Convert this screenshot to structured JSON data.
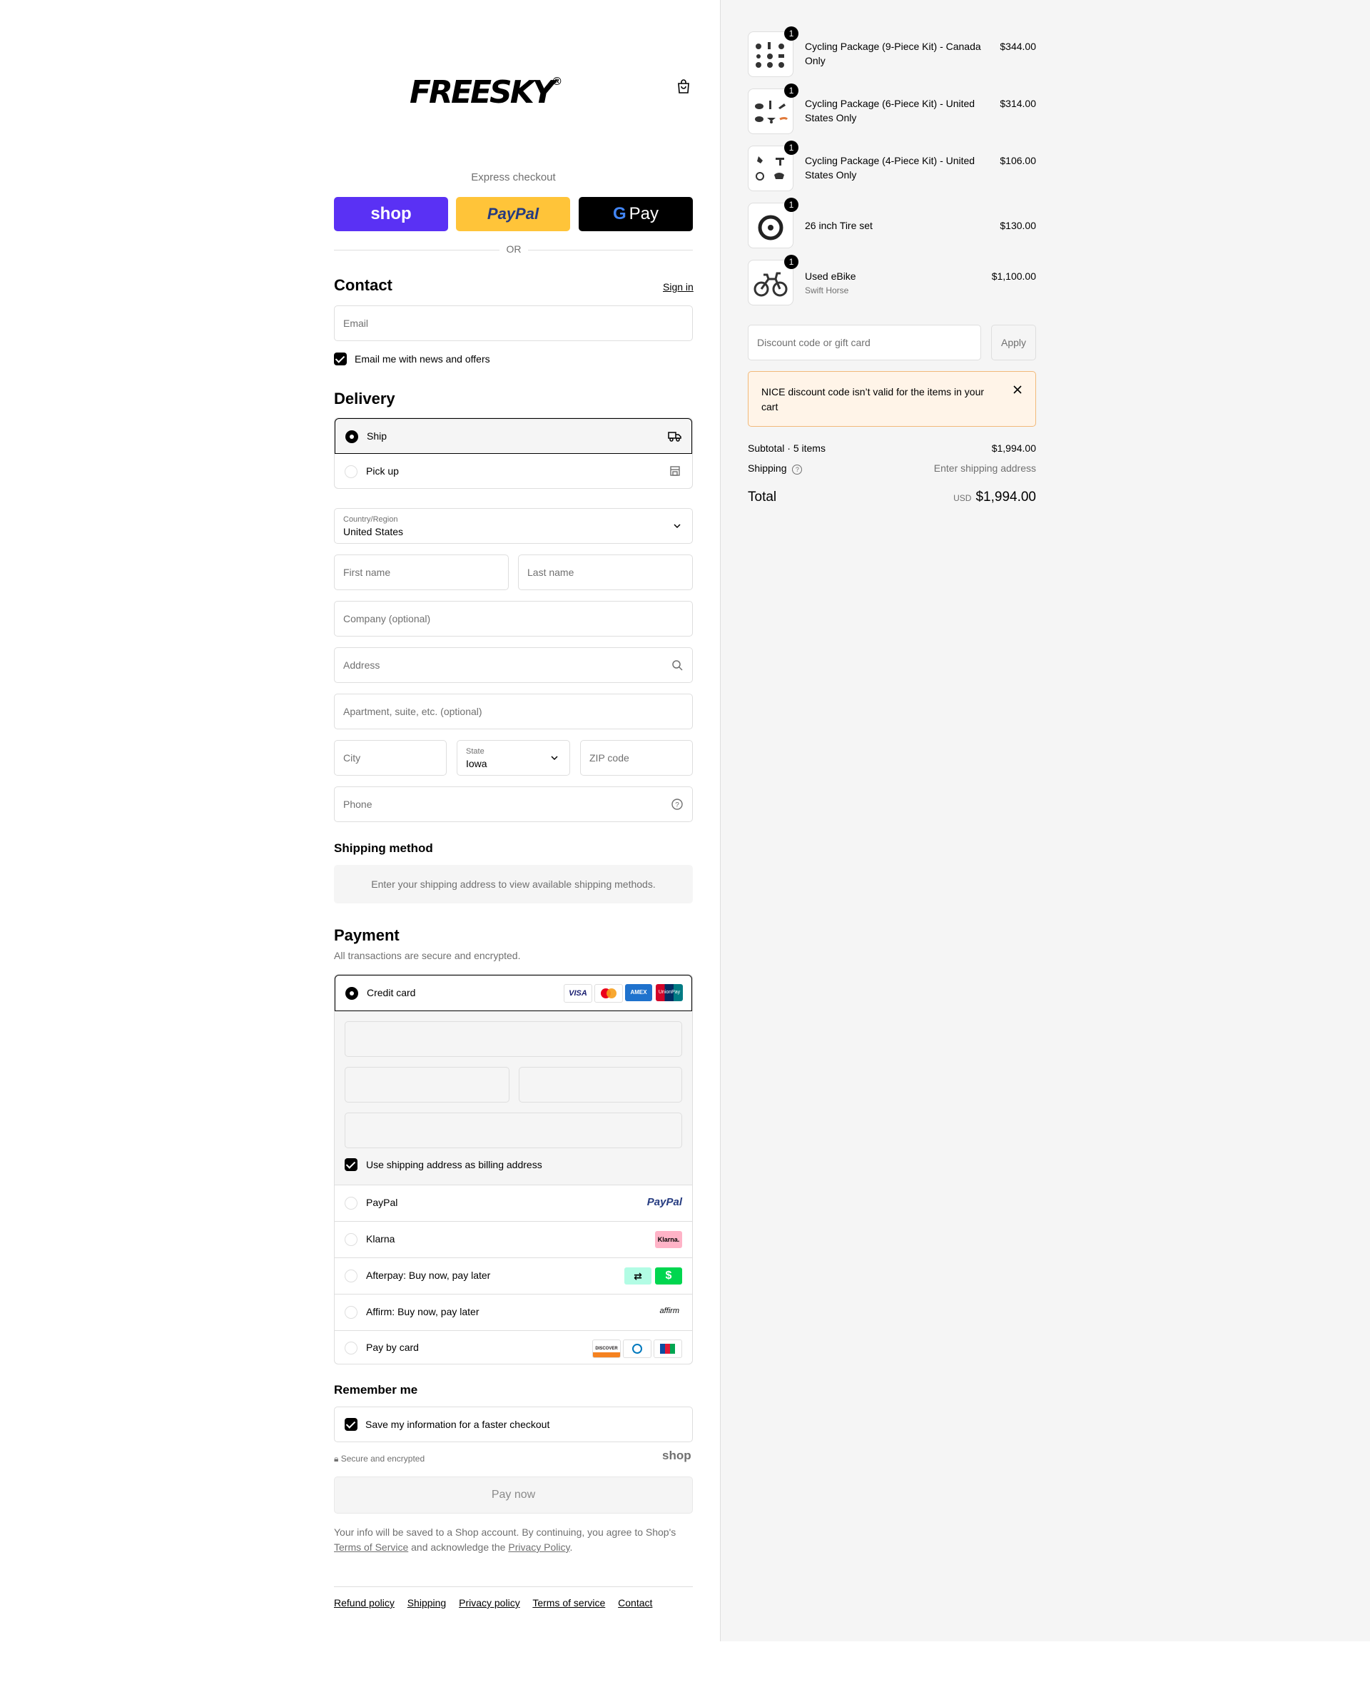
{
  "brand": {
    "logo_text": "FREESKY",
    "registered": "®"
  },
  "express": {
    "title": "Express checkout",
    "shop_label": "shop",
    "paypal_label": "PayPal",
    "gpay_label": "Pay",
    "or_label": "OR"
  },
  "contact": {
    "title": "Contact",
    "sign_in": "Sign in",
    "email_placeholder": "Email",
    "news_label": "Email me with news and offers"
  },
  "delivery": {
    "title": "Delivery",
    "options": [
      {
        "label": "Ship",
        "selected": true
      },
      {
        "label": "Pick up",
        "selected": false
      }
    ],
    "country_label": "Country/Region",
    "country_value": "United States",
    "first_name": "First name",
    "last_name": "Last name",
    "company": "Company (optional)",
    "address": "Address",
    "apartment": "Apartment, suite, etc. (optional)",
    "city": "City",
    "state_label": "State",
    "state_value": "Iowa",
    "zip": "ZIP code",
    "phone": "Phone"
  },
  "shipping_method": {
    "title": "Shipping method",
    "message": "Enter your shipping address to view available shipping methods."
  },
  "payment": {
    "title": "Payment",
    "subtitle": "All transactions are secure and encrypted.",
    "credit_card_label": "Credit card",
    "card_logos": [
      "VISA",
      "AMEX",
      "UnionPay"
    ],
    "billing_label": "Use shipping address as billing address",
    "methods": [
      {
        "label": "PayPal",
        "logo": "PayPal"
      },
      {
        "label": "Klarna",
        "logo": "Klarna."
      },
      {
        "label": "Afterpay: Buy now, pay later",
        "logo": "$"
      },
      {
        "label": "Affirm: Buy now, pay later",
        "logo": "affirm"
      },
      {
        "label": "Pay by card",
        "logo": "DISCOVER"
      }
    ]
  },
  "remember": {
    "title": "Remember me",
    "save_label": "Save my information for a faster checkout",
    "secure_label": "Secure and encrypted",
    "shop_label": "shop"
  },
  "pay_now": "Pay now",
  "legal": {
    "line1": "Your info will be saved to a Shop account. By continuing, you agree to Shop's",
    "terms": "Terms of Service",
    "middle": "and acknowledge the",
    "privacy": "Privacy Policy",
    "end": "."
  },
  "footer_links": [
    "Refund policy",
    "Shipping",
    "Privacy policy",
    "Terms of service",
    "Contact"
  ],
  "cart": {
    "items": [
      {
        "name": "Cycling Package (9-Piece Kit) - Canada Only",
        "qty": "1",
        "price": "$344.00",
        "sub": ""
      },
      {
        "name": "Cycling Package (6-Piece Kit) - United States Only",
        "qty": "1",
        "price": "$314.00",
        "sub": ""
      },
      {
        "name": "Cycling Package (4-Piece Kit) - United States Only",
        "qty": "1",
        "price": "$106.00",
        "sub": ""
      },
      {
        "name": "26 inch Tire set",
        "qty": "1",
        "price": "$130.00",
        "sub": ""
      },
      {
        "name": "Used eBike",
        "qty": "1",
        "price": "$1,100.00",
        "sub": "Swift Horse"
      }
    ],
    "discount_placeholder": "Discount code or gift card",
    "apply_label": "Apply",
    "alert": "NICE discount code isn’t valid for the items in your cart",
    "subtotal_label": "Subtotal · 5 items",
    "subtotal_value": "$1,994.00",
    "shipping_label": "Shipping",
    "shipping_value": "Enter shipping address",
    "total_label": "Total",
    "currency": "USD",
    "total_value": "$1,994.00"
  }
}
